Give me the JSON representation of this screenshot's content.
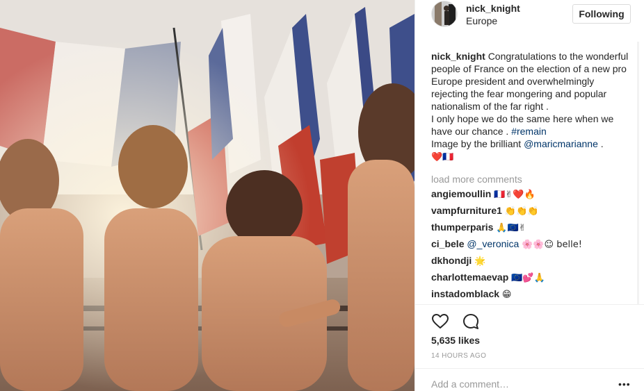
{
  "post": {
    "username": "nick_knight",
    "location": "Europe",
    "follow_label": "Following"
  },
  "caption": {
    "username": "nick_knight",
    "text_1": "Congratulations to the wonderful people of France on the election of a new pro Europe president and overwhelmingly rejecting the fear mongering and popular nationalism of the far right .",
    "text_2": "I only hope we do the same here when we have our chance .",
    "hashtag": "#remain",
    "text_3": "Image by the brilliant",
    "mention": "@maricmarianne",
    "text_4": ".",
    "emojis": "❤️🇫🇷"
  },
  "load_more_label": "load more comments",
  "comments": [
    {
      "username": "angiemoullin",
      "text": "🇫🇷✌❤️🔥"
    },
    {
      "username": "vampfurniture1",
      "text": "👏👏👏"
    },
    {
      "username": "thumperparis",
      "text": "🙏🇪🇺✌"
    },
    {
      "username": "ci_bele",
      "mention": "@_veronica",
      "text": "🌸🌸☺ belle!"
    },
    {
      "username": "dkhondji",
      "text": "🌟"
    },
    {
      "username": "charlottemaevap",
      "text": "🇪🇺💕🙏"
    },
    {
      "username": "instadomblack",
      "text": "😁"
    }
  ],
  "icons": {
    "like": "heart-icon",
    "comment": "comment-icon",
    "more": "more-options-icon"
  },
  "likes_label": "5,635 likes",
  "timestamp": "14 HOURS AGO",
  "add_comment_placeholder": "Add a comment…",
  "more_label": "•••",
  "colors": {
    "link": "#003569",
    "muted": "#999999",
    "text": "#262626",
    "border": "#efefef"
  }
}
